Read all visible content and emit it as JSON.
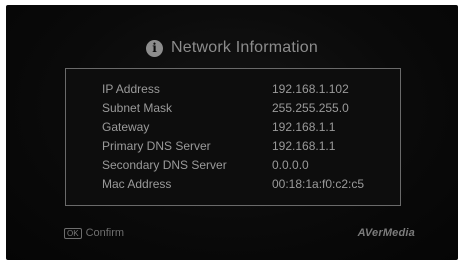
{
  "dialog": {
    "title": "Network Information",
    "icon": "info-icon",
    "rows": [
      {
        "label": "IP Address",
        "value": "192.168.1.102"
      },
      {
        "label": "Subnet Mask",
        "value": "255.255.255.0"
      },
      {
        "label": "Gateway",
        "value": "192.168.1.1"
      },
      {
        "label": "Primary DNS Server",
        "value": "192.168.1.1"
      },
      {
        "label": "Secondary DNS Server",
        "value": "0.0.0.0"
      },
      {
        "label": "Mac Address",
        "value": "00:18:1a:f0:c2:c5"
      }
    ]
  },
  "footer": {
    "ok_key": "OK",
    "confirm_label": "Confirm",
    "brand": "AVerMedia"
  }
}
